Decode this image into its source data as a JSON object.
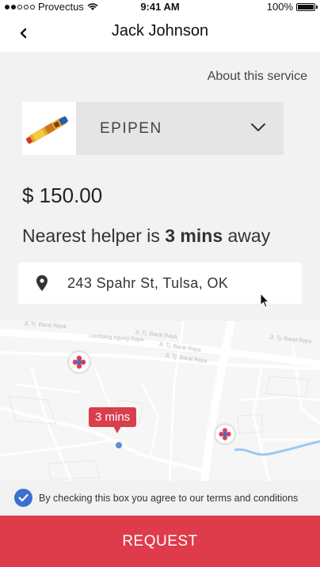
{
  "status_bar": {
    "carrier": "Provectus",
    "time": "9:41 AM",
    "battery": "100%",
    "icons": [
      "signal-dots-icon",
      "wifi-icon",
      "battery-icon"
    ]
  },
  "nav": {
    "title": "Jack Johnson",
    "back_icon": "chevron-left-icon"
  },
  "about_link": "About this service",
  "product": {
    "name": "EPIPEN",
    "thumbnail_icon": "epipen-icon",
    "dropdown_icon": "chevron-down-icon"
  },
  "price": "$ 150.00",
  "eta": {
    "prefix": "Nearest helper is ",
    "bold": "3 mins",
    "suffix": " away"
  },
  "address": {
    "value": "243 Spahr St, Tulsa, OK",
    "icon": "location-pin-icon"
  },
  "map": {
    "labels": [
      "Jl. Tj. Barat Raya",
      "Jl. Tj. Barat Raya",
      "Jl. Tj. Barat Raya",
      "Jl. Tj. Barat Raya",
      "Lembang Agung Raya",
      "Jl. Tj. Barat Raya"
    ],
    "eta_bubble": "3 mins",
    "pin_icon": "helper-marker-icon"
  },
  "terms": {
    "checked": true,
    "text": "By checking this box you agree to our terms and conditions"
  },
  "request_button": "REQUEST",
  "colors": {
    "accent": "#de3c4b",
    "checkbox": "#3b6fd1",
    "background": "#f2f2f2"
  }
}
